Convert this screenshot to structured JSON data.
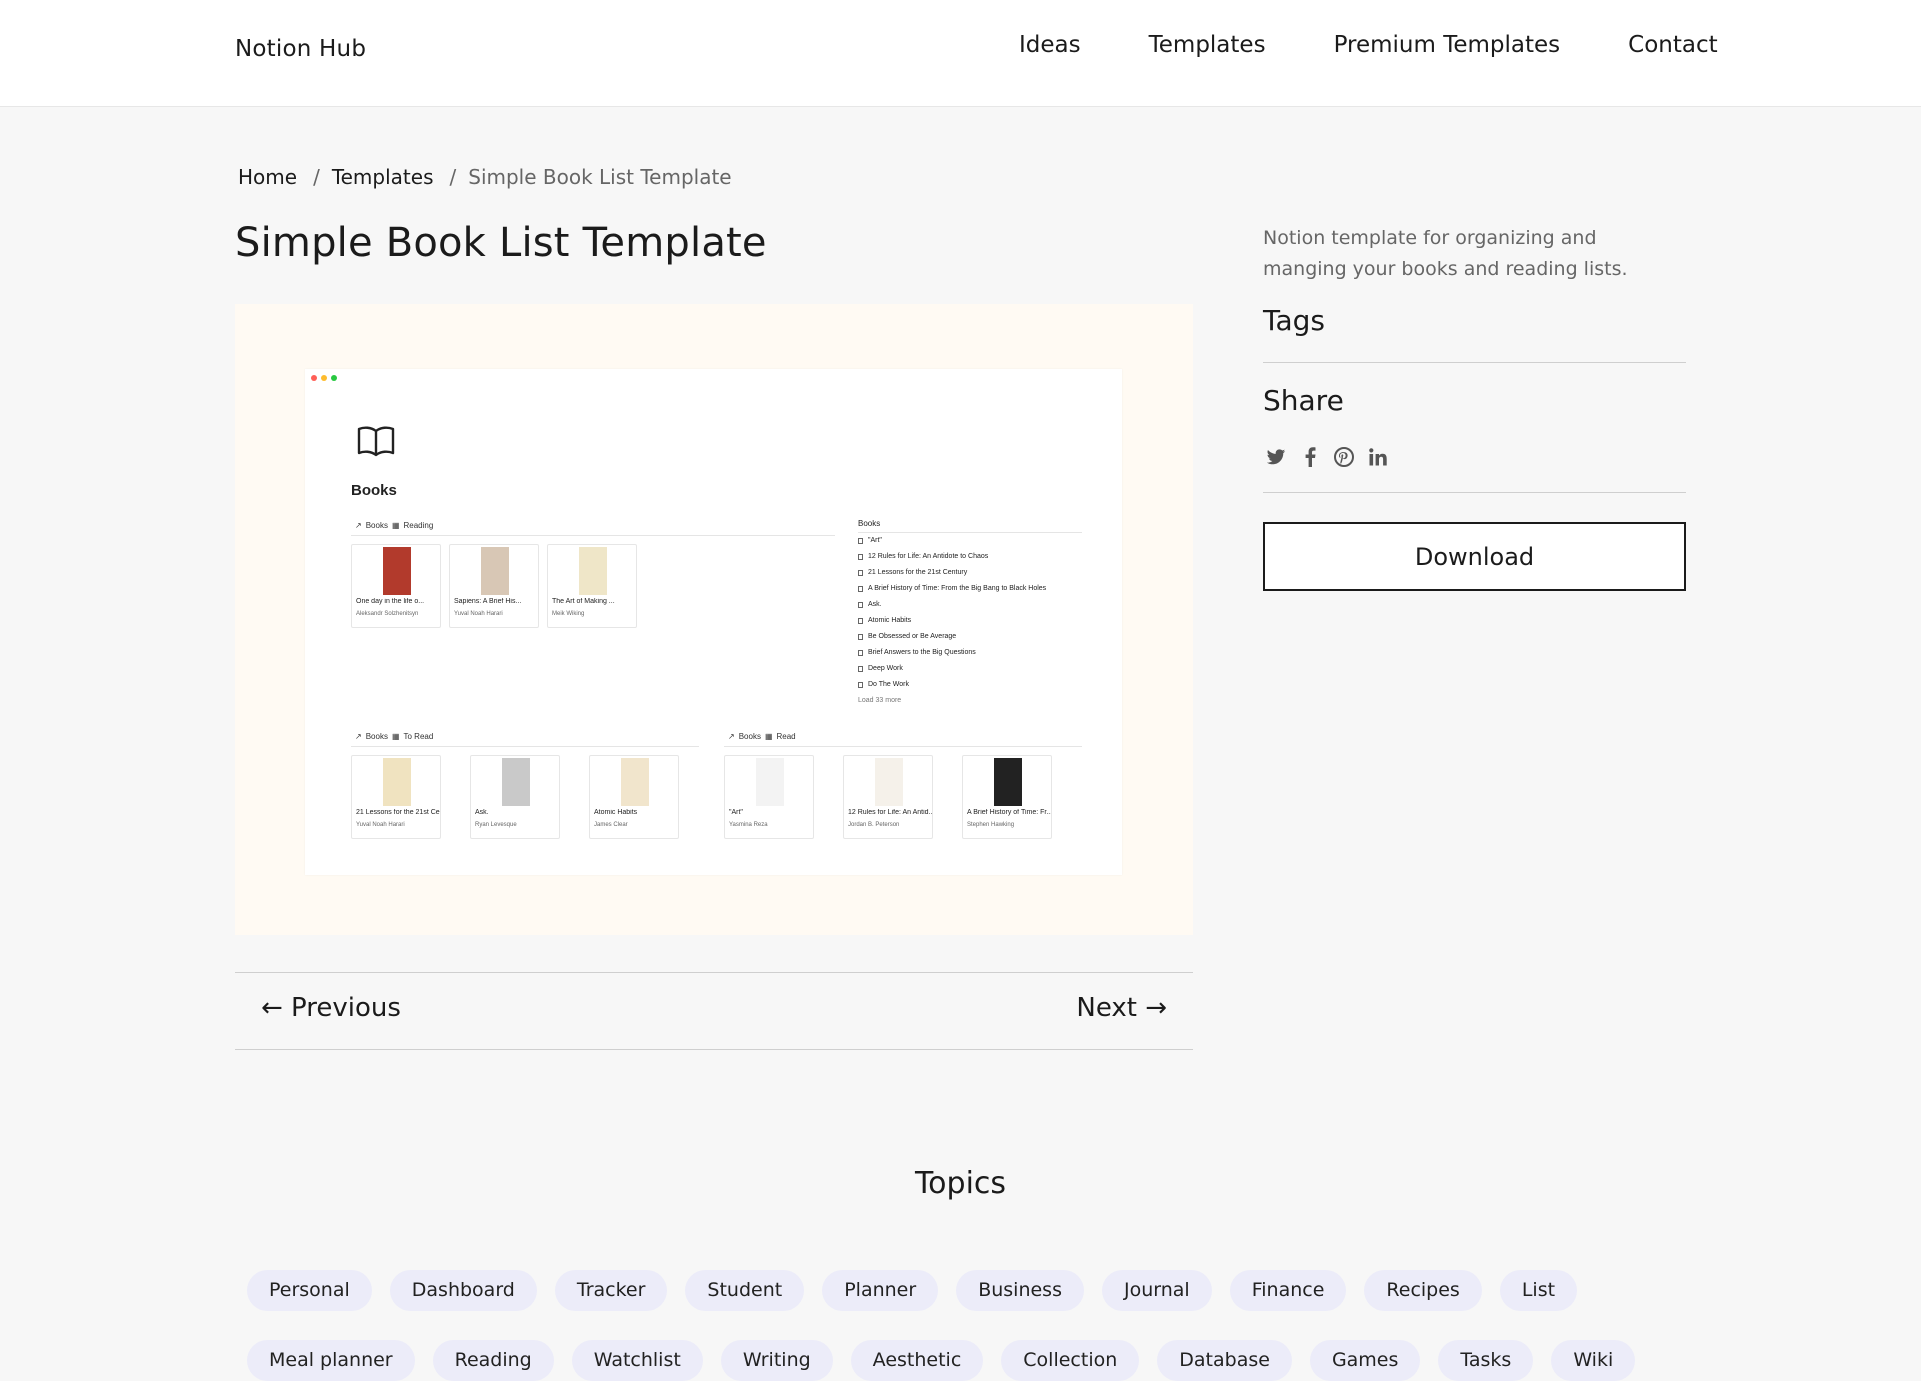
{
  "brand": "Notion Hub",
  "nav": [
    "Ideas",
    "Templates",
    "Premium Templates",
    "Contact"
  ],
  "breadcrumb": {
    "home": "Home",
    "section": "Templates",
    "current": "Simple Book List Template",
    "sep": "/"
  },
  "title": "Simple Book List Template",
  "preview": {
    "heading": "Books",
    "dots": [
      "#ff5f57",
      "#febc2e",
      "#28c840"
    ],
    "reading_label": "Books",
    "reading_view": "Reading",
    "reading_cards": [
      {
        "title": "One day in the life o...",
        "author": "Aleksandr Solzhenitsyn",
        "color": "#b23a2c"
      },
      {
        "title": "Sapiens: A Brief His...",
        "author": "Yuval Noah Harari",
        "color": "#d8c7b5"
      },
      {
        "title": "The Art of Making ...",
        "author": "Meik Wiking",
        "color": "#efe6c8"
      }
    ],
    "list_heading": "Books",
    "list_items": [
      "\"Art\"",
      "12 Rules for Life: An Antidote to Chaos",
      "21 Lessons for the 21st Century",
      "A Brief History of Time: From the Big Bang to Black Holes",
      "Ask.",
      "Atomic Habits",
      "Be Obsessed or Be Average",
      "Brief Answers to the Big Questions",
      "Deep Work",
      "Do The Work"
    ],
    "list_more": "Load 33 more",
    "toread_label": "Books",
    "toread_view": "To Read",
    "toread_cards": [
      {
        "title": "21 Lessons for the 21st Ce...",
        "author": "Yuval Noah Harari",
        "color": "#f0e3c0"
      },
      {
        "title": "Ask.",
        "author": "Ryan Levesque",
        "color": "#c9c9c9"
      },
      {
        "title": "Atomic Habits",
        "author": "James Clear",
        "color": "#f1e5cc"
      }
    ],
    "read_label": "Books",
    "read_view": "Read",
    "read_cards": [
      {
        "title": "\"Art\"",
        "author": "Yasmina Reza",
        "color": "#f3f3f3"
      },
      {
        "title": "12 Rules for Life: An Antid...",
        "author": "Jordan B. Peterson",
        "color": "#f5f1ea"
      },
      {
        "title": "A Brief History of Time: Fr...",
        "author": "Stephen Hawking",
        "color": "#222222"
      }
    ]
  },
  "sidebar": {
    "description": "Notion template for organizing and manging your books and reading lists.",
    "tags_heading": "Tags",
    "share_heading": "Share",
    "share_icons": [
      "twitter-icon",
      "facebook-icon",
      "pinterest-icon",
      "linkedin-icon"
    ],
    "download_label": "Download"
  },
  "pager": {
    "prev": "← Previous",
    "next": "Next →"
  },
  "topics": {
    "title": "Topics",
    "row1": [
      "Personal",
      "Dashboard",
      "Tracker",
      "Student",
      "Planner",
      "Business",
      "Journal",
      "Finance",
      "Recipes",
      "List"
    ],
    "row2": [
      "Meal planner",
      "Reading",
      "Watchlist",
      "Writing",
      "Aesthetic",
      "Collection",
      "Database",
      "Games",
      "Tasks",
      "Wiki"
    ]
  }
}
